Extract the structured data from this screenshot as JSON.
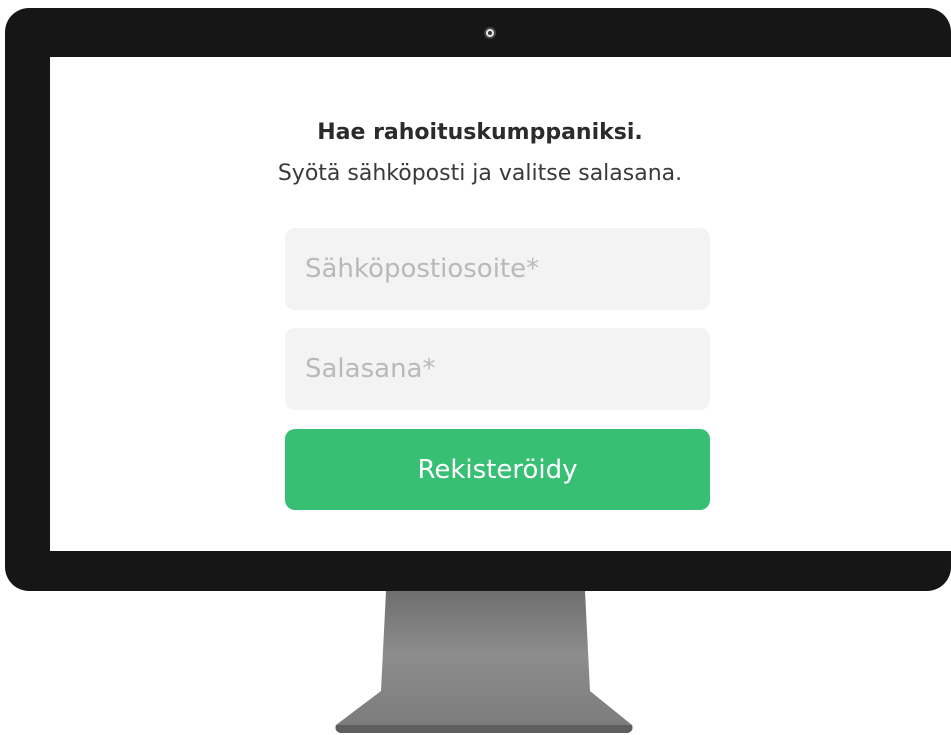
{
  "form": {
    "heading": "Hae rahoituskumppaniksi.",
    "subheading": "Syötä sähköposti ja valitse salasana.",
    "email_placeholder": "Sähköpostiosoite*",
    "email_value": "",
    "password_placeholder": "Salasana*",
    "password_value": "",
    "submit_label": "Rekisteröidy"
  },
  "colors": {
    "accent": "#37bf74",
    "field_background": "#f3f3f3",
    "bezel": "#161616",
    "stand": "#8a8a8a"
  },
  "icons": {
    "camera": "webcam-icon"
  }
}
